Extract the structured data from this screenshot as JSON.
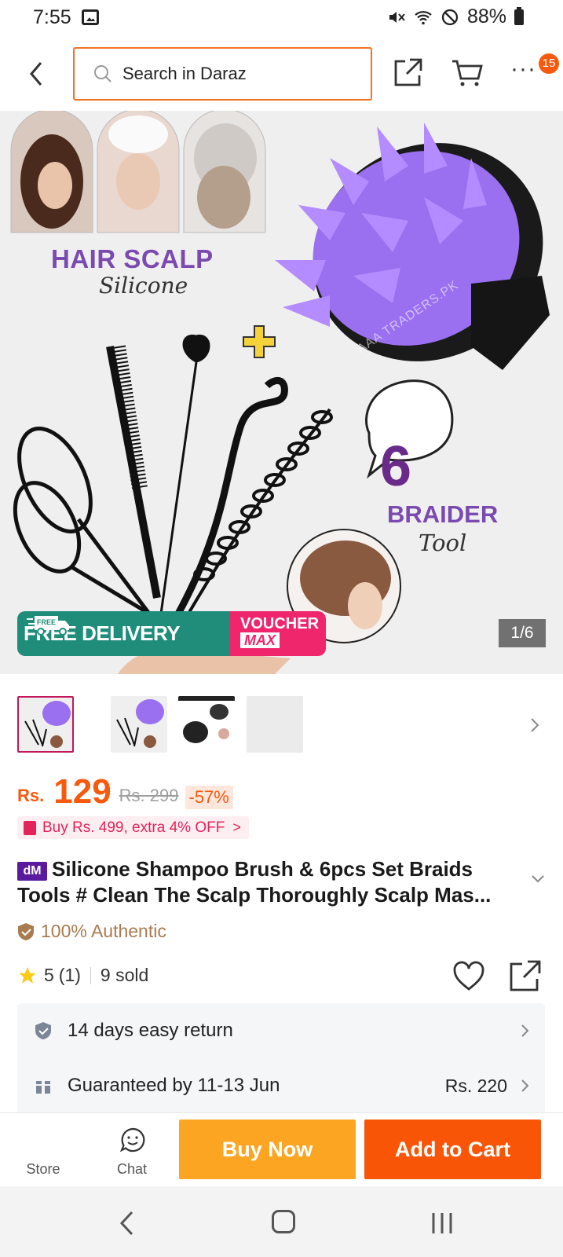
{
  "status_bar": {
    "time": "7:55",
    "battery": "88%",
    "icons": [
      "image-icon",
      "mute-icon",
      "wifi-icon",
      "dnd-icon",
      "battery-icon"
    ]
  },
  "header": {
    "search_placeholder": "Search in Daraz",
    "more_badge": "15",
    "accent_color": "#f57224"
  },
  "hero": {
    "title": "HAIR SCALP",
    "subtitle": "Silicone",
    "number": "6",
    "braider_title": "BRAIDER",
    "braider_sub": "Tool",
    "watermark": "AAA TRADERS.PK",
    "free_delivery": "FREE DELIVERY",
    "free_tag": "FREE",
    "voucher_line1": "VOUCHER",
    "voucher_line2": "MAX",
    "page_counter": "1/6"
  },
  "thumbnails": {
    "count": 4,
    "active_index": 0
  },
  "price": {
    "currency": "Rs.",
    "value": "129",
    "original": "Rs. 299",
    "discount": "-57%",
    "color": "#f55a0e"
  },
  "promo": {
    "text": "Buy Rs. 499, extra 4% OFF",
    "chevron": ">"
  },
  "product": {
    "badge": "dM",
    "title": "Silicone Shampoo Brush & 6pcs Set Braids Tools # Clean The Scalp Thoroughly Scalp Mas...",
    "authentic": "100% Authentic"
  },
  "rating": {
    "value": "5",
    "count": "(1)",
    "sold": "9 sold"
  },
  "services": {
    "return_label": "14 days easy return",
    "delivery_label": "Guaranteed by 11-13 Jun",
    "delivery_price": "Rs. 220"
  },
  "action_bar": {
    "store_label": "Store",
    "chat_label": "Chat",
    "buy_now": "Buy Now",
    "add_to_cart": "Add to Cart",
    "buy_color": "#fca522",
    "cart_color": "#f85606"
  }
}
